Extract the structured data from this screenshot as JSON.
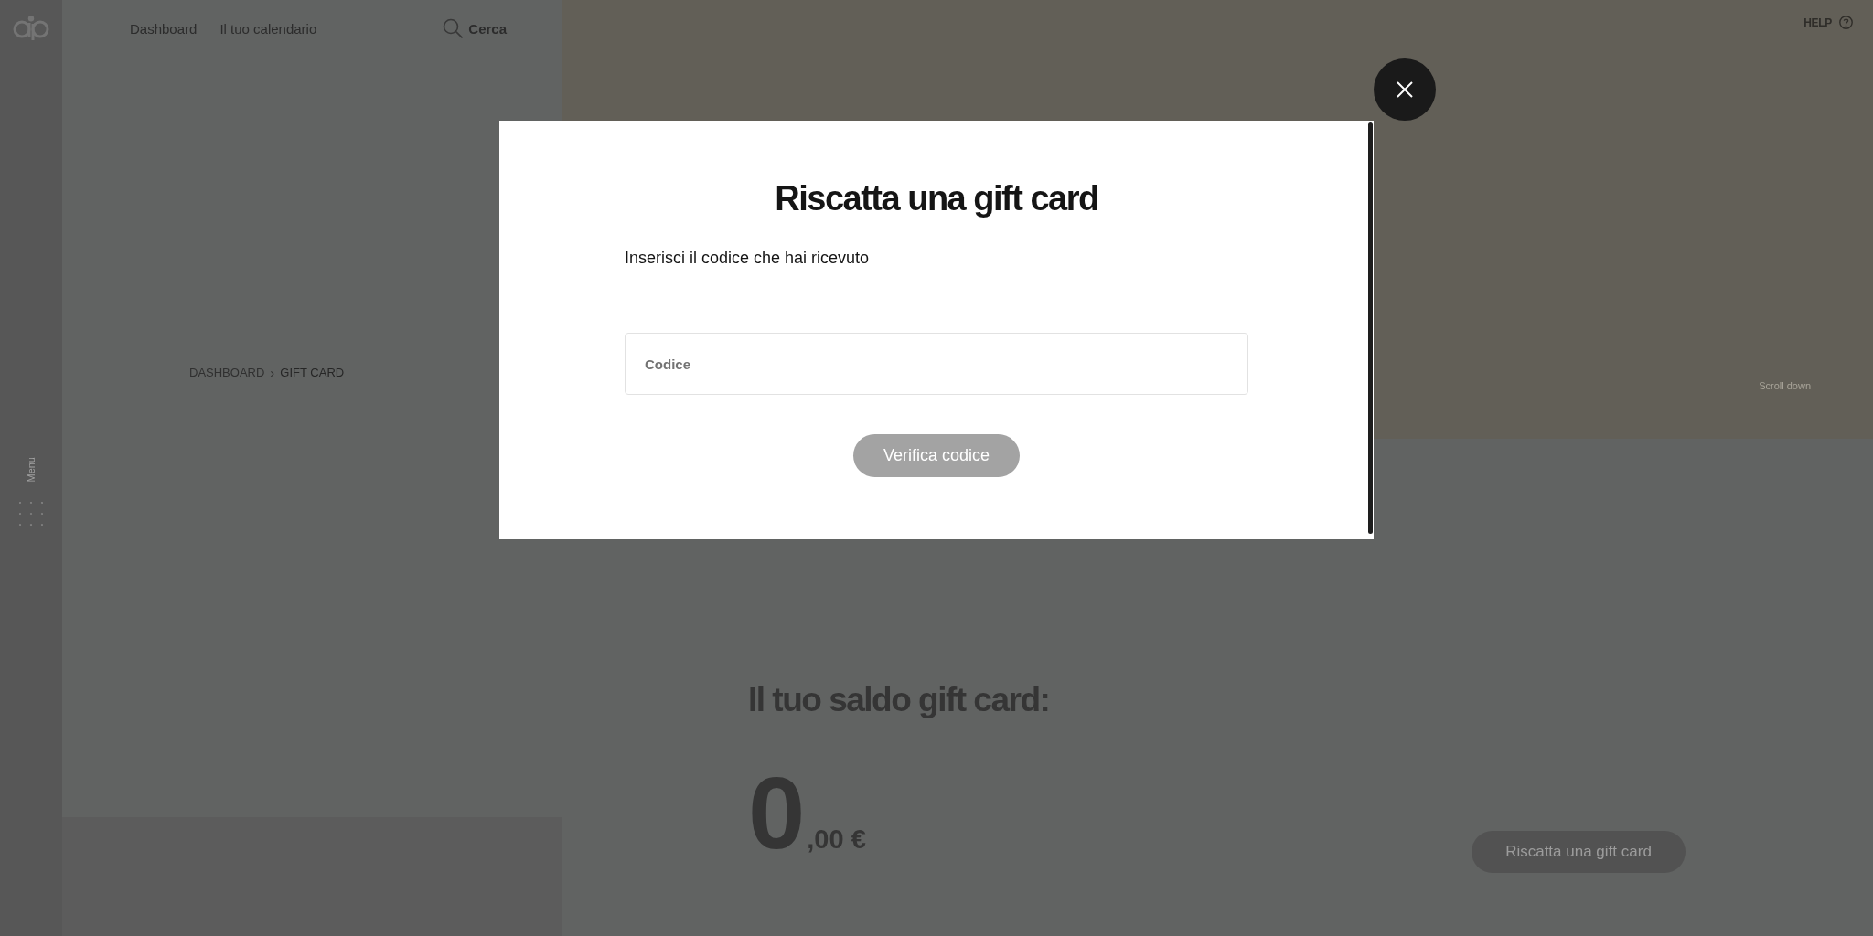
{
  "sidebar": {
    "menu_label": "Menu"
  },
  "header": {
    "nav": [
      {
        "label": "Dashboard"
      },
      {
        "label": "Il tuo calendario"
      }
    ],
    "search": {
      "label": "Cerca"
    }
  },
  "breadcrumb": {
    "items": [
      "DASHBOARD",
      "GIFT CARD"
    ],
    "separator": "›"
  },
  "hero": {
    "help_label": "HELP",
    "scroll_hint": "Scroll down"
  },
  "balance": {
    "heading": "Il tuo saldo gift card:",
    "integer": "0",
    "decimals": ",00 €",
    "redeem_button": "Riscatta una gift card"
  },
  "modal": {
    "title": "Riscatta una gift card",
    "instruction": "Inserisci il codice che hai ricevuto",
    "code_field": {
      "placeholder": "Codice"
    },
    "verify_button": {
      "label": "Verifica codice",
      "disabled": true
    }
  }
}
